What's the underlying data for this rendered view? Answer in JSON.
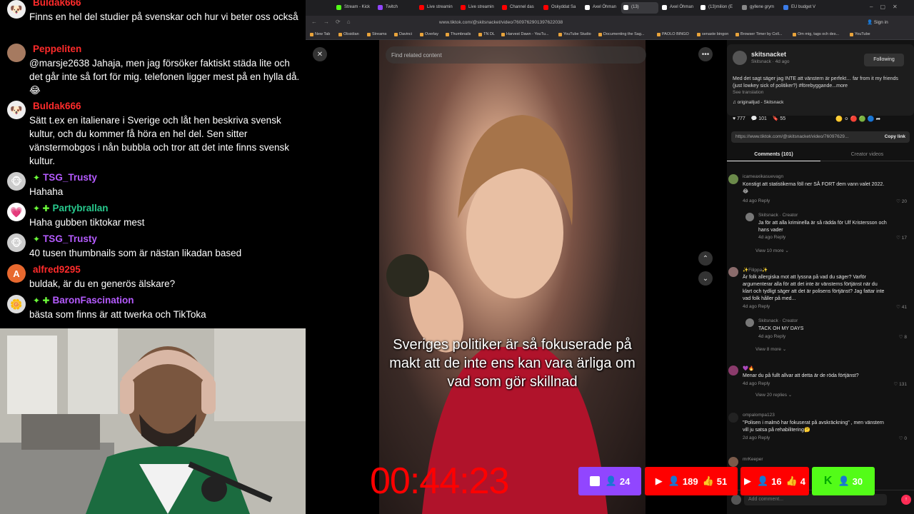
{
  "chat": [
    {
      "user": "Buldak666",
      "color": "#ff2b2b",
      "badges": "",
      "text": "Finns en hel del studier på svenskar och hur vi beter oss också"
    },
    {
      "user": "Peppeliten",
      "color": "#ff2b2b",
      "badges": "",
      "text": "@marsje2638 Jahaja, men jag försöker faktiskt städa lite och det går inte så fort för mig. telefonen ligger mest på en hylla då. 😂"
    },
    {
      "user": "Buldak666",
      "color": "#ff2b2b",
      "badges": "",
      "text": "Sätt t.ex en italienare i Sverige och låt hen beskriva svensk kultur, och du kommer få höra en hel del. Sen sitter vänstermobgos i nån bubbla och tror att det inte finns svensk kultur."
    },
    {
      "user": "TSG_Trusty",
      "color": "#b55bff",
      "badges": "✦",
      "text": "Hahaha"
    },
    {
      "user": "Partybrallan",
      "color": "#27c98d",
      "badges": "✦ ✚",
      "text": "Haha gubben tiktokar mest"
    },
    {
      "user": "TSG_Trusty",
      "color": "#b55bff",
      "badges": "✦",
      "text": "40 tusen thumbnails som är nästan likadan based"
    },
    {
      "user": "alfred9295",
      "color": "#ff2b2b",
      "badges": "",
      "text": "buldak, är du en generös älskare?"
    },
    {
      "user": "BaronFascination",
      "color": "#b55bff",
      "badges": "✦ ✚",
      "text": "bästa som finns är att twerka och TikToka"
    }
  ],
  "browser": {
    "tabs": [
      "Stream - Kick",
      "Twitch",
      "Live streamin",
      "Live streamin",
      "Channel das",
      "Oskyddat Sa",
      "Axel Öhman",
      "(13)",
      "Axel Öhman",
      "(13)milion (E",
      "gyllene grym",
      "EU budget V"
    ],
    "url": "www.tiktok.com/@skitsnacket/video/7609762901397622038",
    "sign_in": "Sign in",
    "bookmarks": [
      "New Tab",
      "Obsidian",
      "Streams",
      "Davinci",
      "Overlay",
      "Thumbnails",
      "TN DL",
      "Harvest Dawn - YouTu...",
      "YouTube Studio",
      "Documenting the Sag...",
      "PAOLO BINGO",
      "senaste bingon",
      "Browser Timer by Coll...",
      "Om mig, tags och des...",
      "YouTube"
    ]
  },
  "video": {
    "search_placeholder": "Find related content",
    "subtitle": "Sveriges politiker är så fokuserade på makt att de inte ens kan vara ärliga om vad som gör skillnad"
  },
  "post": {
    "author": "skitsnacket",
    "meta": "Skitsnack · 4d ago",
    "follow": "Following",
    "desc": "Med det sagt säger jag INTE att vänstern är perfekt… far from it my friends (just lowkey sick of politiker?) #förebyggande...more",
    "see_translation": "See translation",
    "sound": "♫ originalljud - Skitsnack",
    "likes": "777",
    "comments": "101",
    "saves": "55",
    "link": "https://www.tiktok.com/@skitsnacket/video/76097629...",
    "copy_link": "Copy link",
    "tab_comments": "Comments (101)",
    "tab_creator": "Creator videos",
    "add_comment": "Add comment..."
  },
  "comments": [
    {
      "user": "icameaxikasuevagn",
      "text": "Konstigt att statistikerna föll ner SÅ FORT dem vann valet 2022. 😂",
      "meta": "4d ago  Reply",
      "likes": "20"
    },
    {
      "user": "Skitsnack · Creator",
      "text": "Ja för att alla kriminella är så rädda för Ulf Kristersson och hans vader",
      "meta": "4d ago  Reply",
      "likes": "17"
    },
    {
      "user": "View 10 more ⌄",
      "text": "",
      "meta": "",
      "likes": ""
    },
    {
      "user": "✨Filippa✨",
      "text": "Är folk allergiska mot att lyssna på vad du säger? Varför argumenterar alla för att det inte är vänsterns förtjänst när du klart och tydligt säger att det är polisens förtjänst? Jag fattar inte vad folk håller på med...",
      "meta": "4d ago  Reply",
      "likes": "41"
    },
    {
      "user": "Skitsnack · Creator",
      "text": "TACK OH MY DAYS",
      "meta": "4d ago  Reply",
      "likes": "8"
    },
    {
      "user": "View 8 more ⌄",
      "text": "",
      "meta": "",
      "likes": ""
    },
    {
      "user": "💜🔥",
      "text": "Menar du på fullt allvar att detta är de röda förtjänst?",
      "meta": "4d ago  Reply",
      "likes": "131"
    },
    {
      "user": "View 20 replies ⌄",
      "text": "",
      "meta": "",
      "likes": ""
    },
    {
      "user": "ompalompa123",
      "text": "\"Polisen i malmö har fokuserat på avskräckning\" , men vänstern vill ju satsa på rehabilitering🤔",
      "meta": "2d ago  Reply",
      "likes": "0"
    },
    {
      "user": "mrKeeper",
      "text": "",
      "meta": "",
      "likes": ""
    }
  ],
  "overlay": {
    "timer": "00:44:23",
    "twitch_viewers": "24",
    "yt1_viewers": "189",
    "yt1_likes": "51",
    "yt2_viewers": "16",
    "yt2_likes": "4",
    "kick_viewers": "30"
  }
}
